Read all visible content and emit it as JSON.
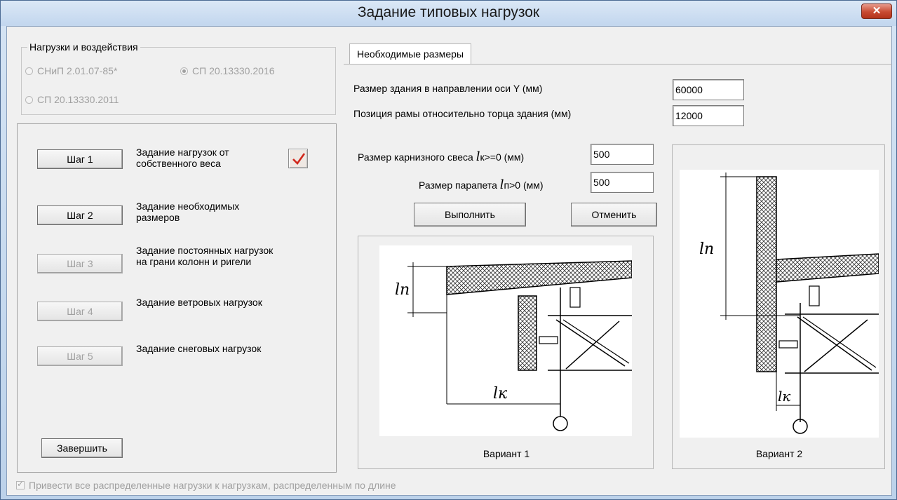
{
  "window": {
    "title": "Задание типовых нагрузок",
    "close_label": "✕"
  },
  "loads_group": {
    "legend": "Нагрузки и воздействия",
    "options": [
      {
        "label": "СНиП 2.01.07-85*",
        "selected": false
      },
      {
        "label": "СП 20.13330.2016",
        "selected": true
      },
      {
        "label": "СП 20.13330.2011",
        "selected": false
      }
    ]
  },
  "steps": [
    {
      "button": "Шаг 1",
      "text": "Задание нагрузок от собственного веса",
      "enabled": true,
      "done": true
    },
    {
      "button": "Шаг 2",
      "text": "Задание необходимых размеров",
      "enabled": true,
      "done": false
    },
    {
      "button": "Шаг 3",
      "text": "Задание постоянных нагрузок на грани колонн и ригели",
      "enabled": false,
      "done": false
    },
    {
      "button": "Шаг 4",
      "text": "Задание ветровых нагрузок",
      "enabled": false,
      "done": false
    },
    {
      "button": "Шаг 5",
      "text": "Задание снеговых нагрузок",
      "enabled": false,
      "done": false
    }
  ],
  "finish_button": "Завершить",
  "tab": {
    "label": "Необходимые размеры"
  },
  "form": {
    "building_size_label": "Размер здания в направлении оси Y (мм)",
    "building_size_value": "60000",
    "frame_position_label": "Позиция рамы относительно торца здания (мм)",
    "frame_position_value": "12000",
    "eave_label_prefix": "Размер карнизного свеса ",
    "eave_symbol": "l",
    "eave_label_suffix": "к>=0 (мм)",
    "eave_value": "500",
    "parapet_label_prefix": "Размер парапета ",
    "parapet_symbol": "l",
    "parapet_label_suffix": "п>0 (мм)",
    "parapet_value": "500",
    "execute_button": "Выполнить",
    "cancel_button": "Отменить"
  },
  "figures": {
    "variant1_caption": "Вариант 1",
    "variant2_caption": "Вариант 2",
    "label_ln": "lп",
    "label_lk": "lк"
  },
  "bottom_checkbox": {
    "label": "Привести все распределенные нагрузки к нагрузкам, распределенным по длине",
    "checked": true
  }
}
